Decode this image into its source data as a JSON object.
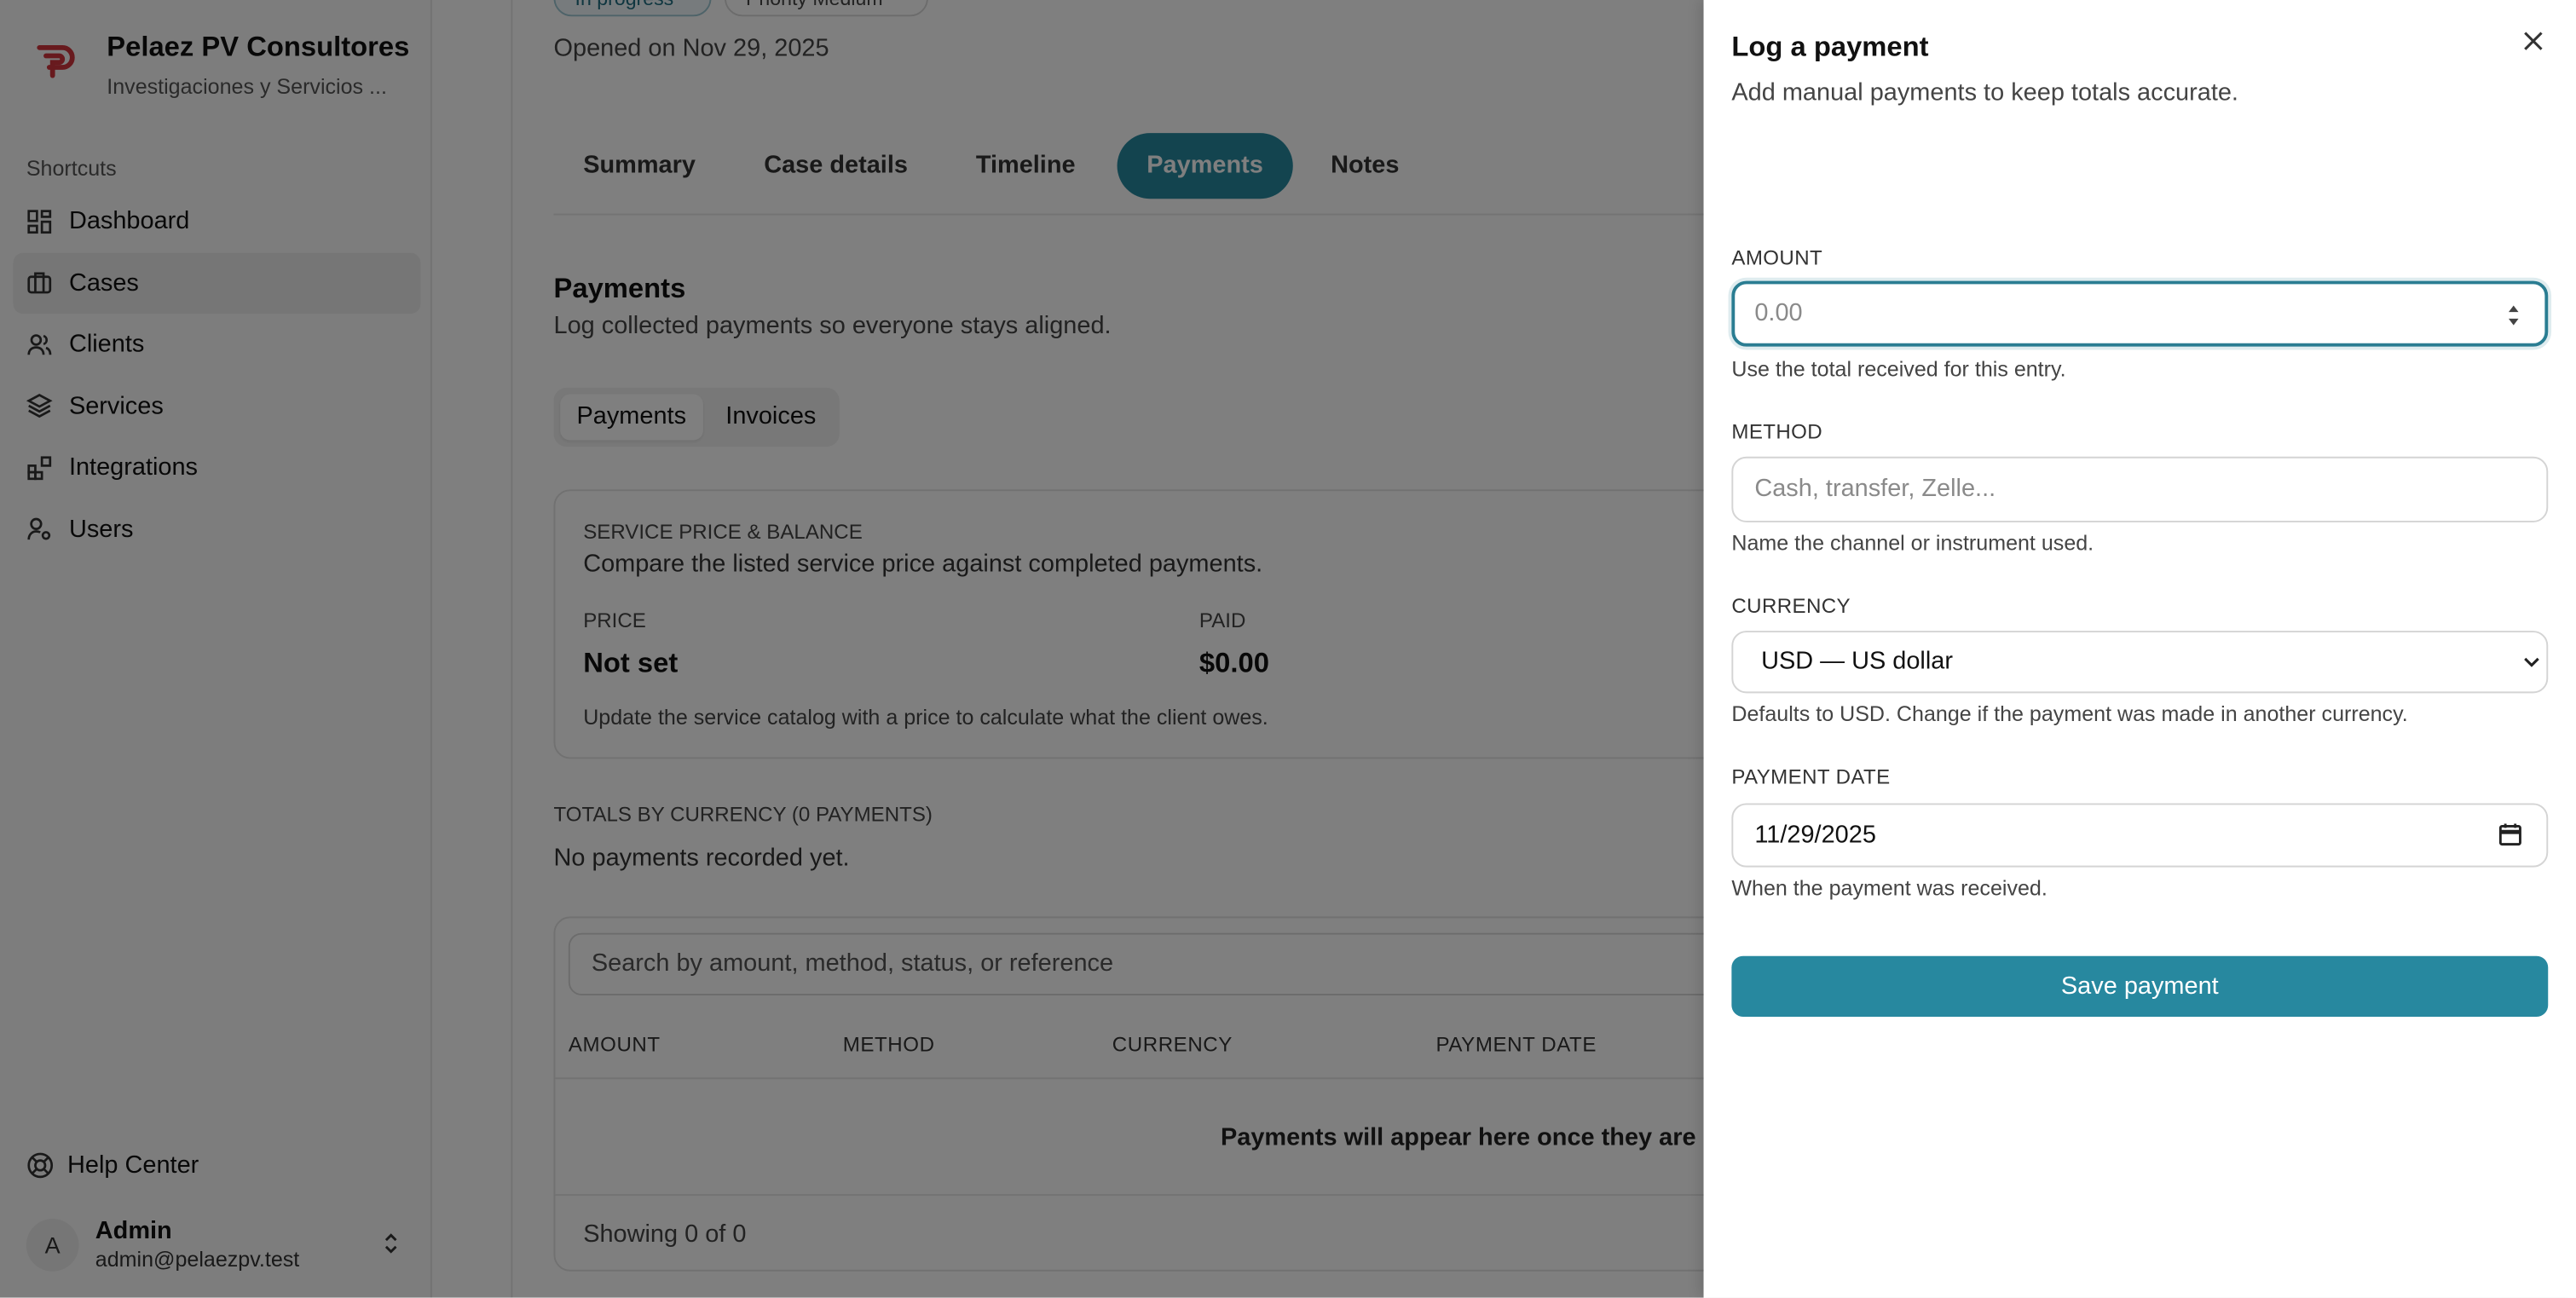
{
  "brand": {
    "name": "Pelaez PV Consultores",
    "subtitle": "Investigaciones y Servicios ..."
  },
  "sidebar": {
    "section_label": "Shortcuts",
    "items": [
      {
        "label": "Dashboard",
        "icon": "dashboard-icon"
      },
      {
        "label": "Cases",
        "icon": "briefcase-icon",
        "active": true
      },
      {
        "label": "Clients",
        "icon": "users-icon"
      },
      {
        "label": "Services",
        "icon": "layers-icon"
      },
      {
        "label": "Integrations",
        "icon": "blocks-icon"
      },
      {
        "label": "Users",
        "icon": "user-cog-icon"
      }
    ],
    "help": "Help Center",
    "user": {
      "initial": "A",
      "name": "Admin",
      "email": "admin@pelaezpv.test"
    }
  },
  "case": {
    "status": "In progress",
    "priority": "Priority Medium",
    "opened": "Opened on Nov 29, 2025",
    "tabs": [
      "Summary",
      "Case details",
      "Timeline",
      "Payments",
      "Notes"
    ],
    "active_tab": "Payments"
  },
  "payments": {
    "title": "Payments",
    "subtitle": "Log collected payments so everyone stays aligned.",
    "segments": [
      "Payments",
      "Invoices"
    ],
    "card": {
      "kicker": "SERVICE PRICE & BALANCE",
      "description": "Compare the listed service price against completed payments.",
      "price_label": "PRICE",
      "price_value": "Not set",
      "paid_label": "PAID",
      "paid_value": "$0.00",
      "note": "Update the service catalog with a price to calculate what the client owes."
    },
    "totals_label": "TOTALS BY CURRENCY (0 PAYMENTS)",
    "totals_value": "No payments recorded yet.",
    "table": {
      "search_placeholder": "Search by amount, method, status, or reference",
      "columns": [
        "AMOUNT",
        "METHOD",
        "CURRENCY",
        "PAYMENT DATE"
      ],
      "empty": "Payments will appear here once they are lo",
      "showing": "Showing 0 of 0"
    }
  },
  "drawer": {
    "title": "Log a payment",
    "subtitle": "Add manual payments to keep totals accurate.",
    "amount": {
      "label": "AMOUNT",
      "placeholder": "0.00",
      "hint": "Use the total received for this entry."
    },
    "method": {
      "label": "METHOD",
      "placeholder": "Cash, transfer, Zelle...",
      "hint": "Name the channel or instrument used."
    },
    "currency": {
      "label": "CURRENCY",
      "value": "USD — US dollar",
      "hint": "Defaults to USD. Change if the payment was made in another currency."
    },
    "date": {
      "label": "PAYMENT DATE",
      "value": "11/29/2025",
      "hint": "When the payment was received."
    },
    "save": "Save payment"
  },
  "colors": {
    "accent": "#27889f",
    "brand_red": "#d0343c",
    "overlay": "rgba(0,0,0,0.5)"
  }
}
